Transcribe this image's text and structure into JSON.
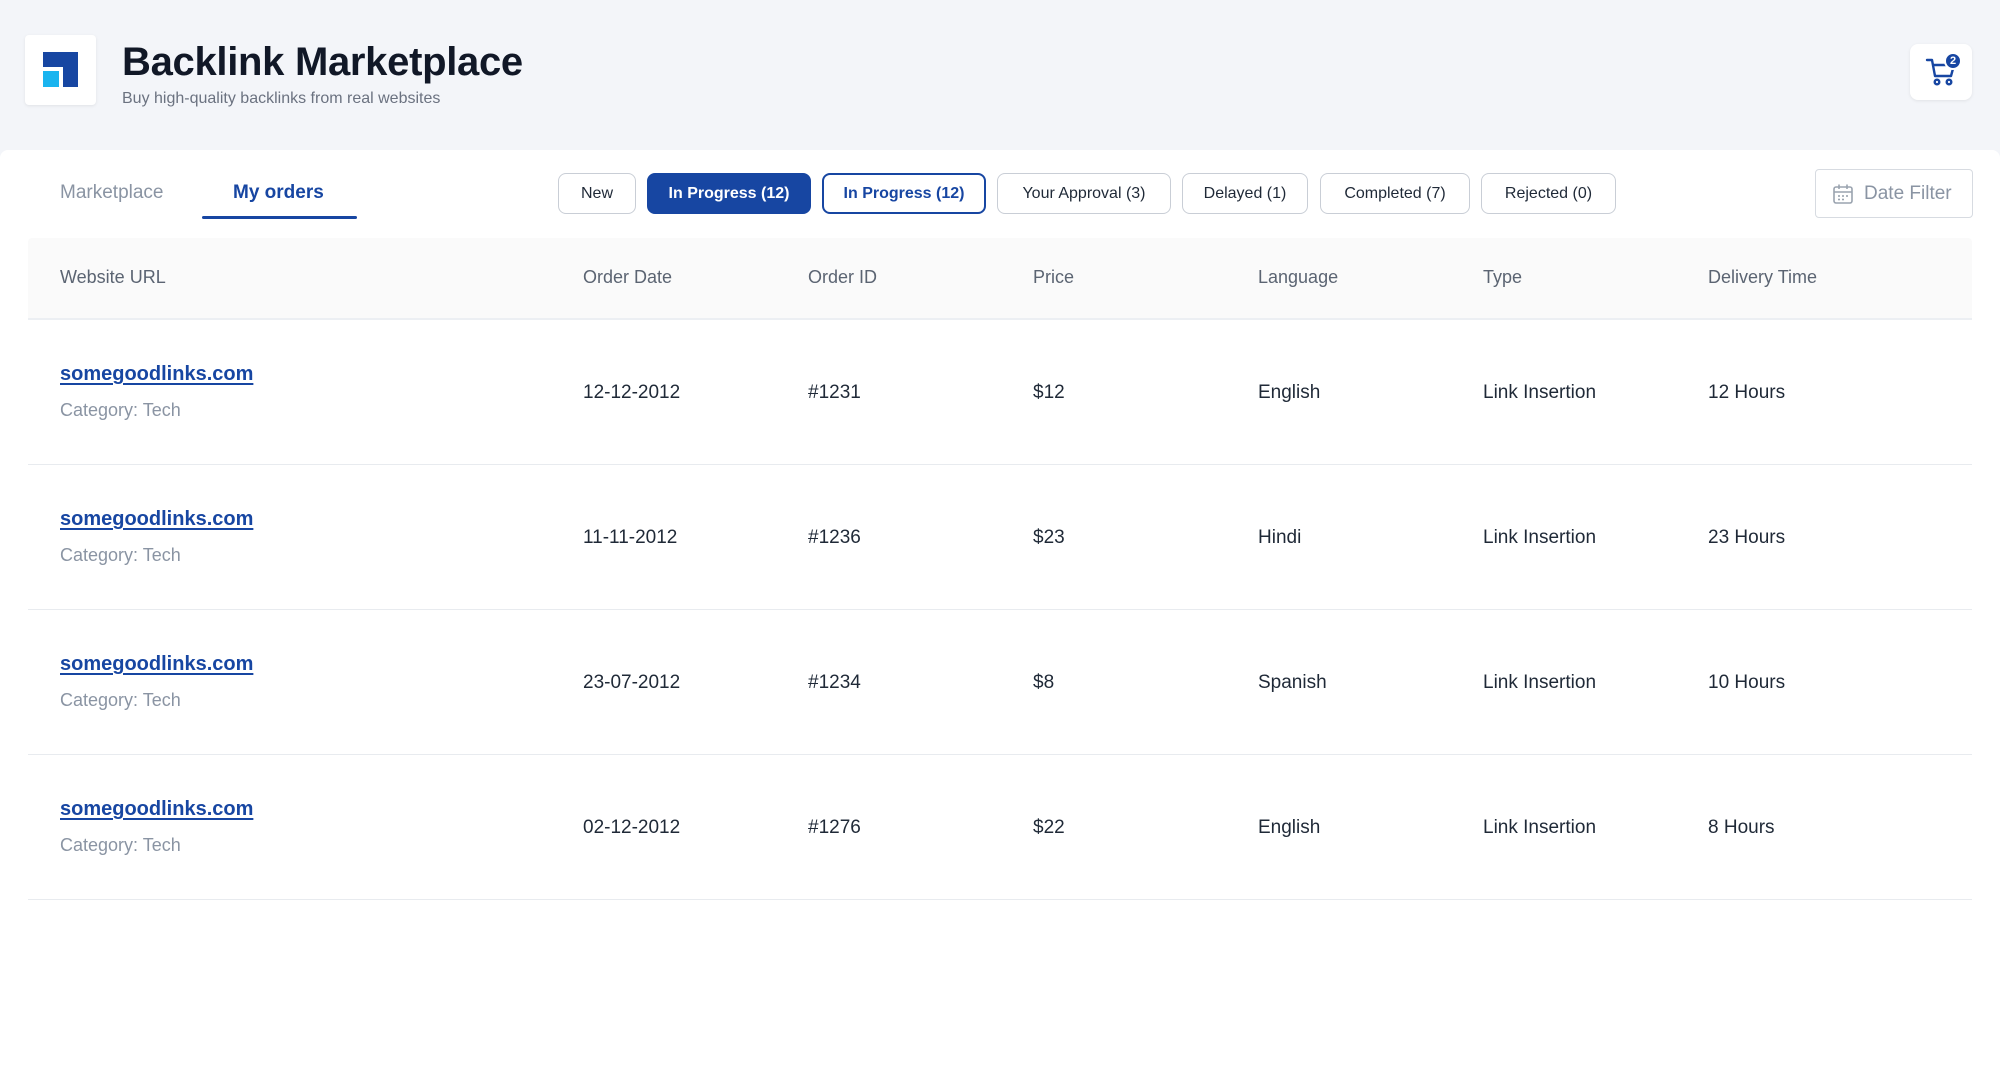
{
  "header": {
    "title": "Backlink Marketplace",
    "subtitle": "Buy high-quality backlinks from real websites",
    "cart_count": "2",
    "logo_icon": "logo-icon",
    "cart_icon": "cart-icon"
  },
  "tabs": [
    {
      "label": "Marketplace",
      "active": false
    },
    {
      "label": "My orders",
      "active": true
    }
  ],
  "filters": [
    {
      "label": "New",
      "state": "default"
    },
    {
      "label": "In Progress (12)",
      "state": "active"
    },
    {
      "label": "In Progress (12)",
      "state": "outlined"
    },
    {
      "label": "Your Approval (3)",
      "state": "default"
    },
    {
      "label": "Delayed (1)",
      "state": "default"
    },
    {
      "label": "Completed (7)",
      "state": "default"
    },
    {
      "label": "Rejected (0)",
      "state": "default"
    }
  ],
  "date_filter": {
    "label": "Date Filter",
    "icon": "calendar-icon"
  },
  "table": {
    "columns": [
      "Website URL",
      "Order Date",
      "Order ID",
      "Price",
      "Language",
      "Type",
      "Delivery Time"
    ],
    "rows": [
      {
        "url": "somegoodlinks.com",
        "category": "Category: Tech",
        "date": "12-12-2012",
        "id": "#1231",
        "price": "$12",
        "language": "English",
        "type": "Link Insertion",
        "delivery": "12 Hours"
      },
      {
        "url": "somegoodlinks.com",
        "category": "Category: Tech",
        "date": "11-11-2012",
        "id": "#1236",
        "price": "$23",
        "language": "Hindi",
        "type": "Link Insertion",
        "delivery": "23 Hours"
      },
      {
        "url": "somegoodlinks.com",
        "category": "Category: Tech",
        "date": "23-07-2012",
        "id": "#1234",
        "price": "$8",
        "language": "Spanish",
        "type": "Link Insertion",
        "delivery": "10 Hours"
      },
      {
        "url": "somegoodlinks.com",
        "category": "Category: Tech",
        "date": "02-12-2012",
        "id": "#1276",
        "price": "$22",
        "language": "English",
        "type": "Link Insertion",
        "delivery": "8 Hours"
      }
    ]
  },
  "colors": {
    "accent": "#1746a2",
    "logo_light": "#1ab4ef"
  }
}
